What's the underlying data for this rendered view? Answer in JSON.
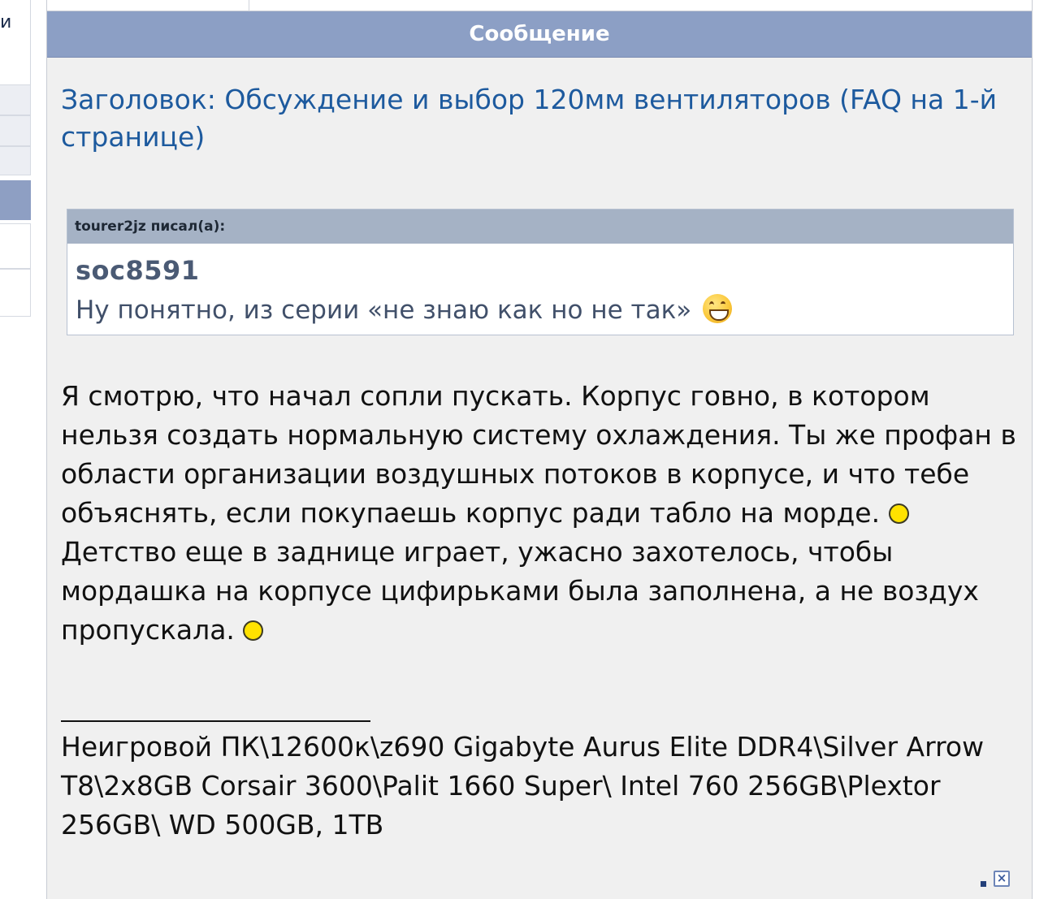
{
  "sidebar": {
    "top_glyph": "и"
  },
  "post": {
    "header": "Сообщение",
    "title": "Заголовок: Обсуждение и выбор 120мм вентиляторов (FAQ на 1-й странице)",
    "quote": {
      "head": "tourer2jz писал(а):",
      "author": "soc8591",
      "text": "Ну понятно, из серии «не знаю как но не так»",
      "emoji": "grin-emoji"
    },
    "body": {
      "part1": "Я смотрю, что начал сопли пускать. Корпус говно, в котором нельзя создать нормальную систему охлаждения. Ты же профан в области организации воздушных потоков в корпусе, и что тебе объяснять, если покупаешь корпус ради табло на морде.",
      "part2": " Детство еще в заднице играет, ужасно захотелось, чтобы мордашка на корпусе цифирьками была заполнена, а не воздух пропускала.",
      "smiley_icon": "smiley-icon"
    },
    "signature": "Неигровой ПК\\12600к\\z690 Gigabyte Aurus Elite DDR4\\Silver Arrow T8\\2x8GB Corsair 3600\\Palit 1660 Super\\ Intel 760 256GB\\Plextor 256GB\\ WD 500GB, 1TB",
    "report_icon": "close-icon"
  }
}
